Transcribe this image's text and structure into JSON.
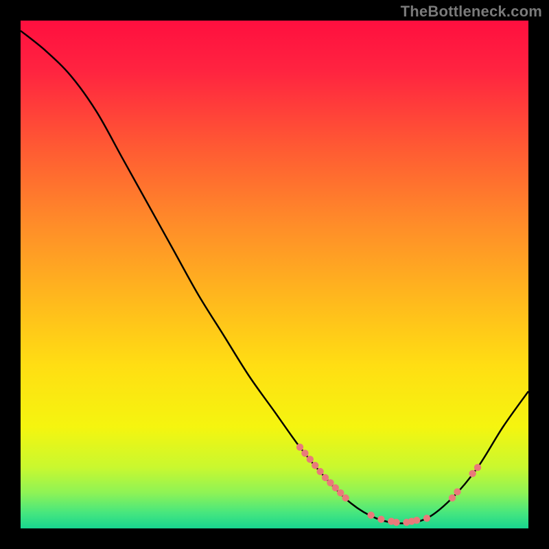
{
  "watermark": "TheBottleneck.com",
  "chart_data": {
    "type": "line",
    "title": "",
    "xlabel": "",
    "ylabel": "",
    "xlim": [
      0,
      100
    ],
    "ylim": [
      0,
      100
    ],
    "curve": [
      {
        "x": 0,
        "y": 98
      },
      {
        "x": 5,
        "y": 94
      },
      {
        "x": 10,
        "y": 89
      },
      {
        "x": 15,
        "y": 82
      },
      {
        "x": 20,
        "y": 73
      },
      {
        "x": 25,
        "y": 64
      },
      {
        "x": 30,
        "y": 55
      },
      {
        "x": 35,
        "y": 46
      },
      {
        "x": 40,
        "y": 38
      },
      {
        "x": 45,
        "y": 30
      },
      {
        "x": 50,
        "y": 23
      },
      {
        "x": 55,
        "y": 16
      },
      {
        "x": 60,
        "y": 10
      },
      {
        "x": 65,
        "y": 5
      },
      {
        "x": 70,
        "y": 2
      },
      {
        "x": 75,
        "y": 1
      },
      {
        "x": 80,
        "y": 2
      },
      {
        "x": 85,
        "y": 6
      },
      {
        "x": 90,
        "y": 12
      },
      {
        "x": 95,
        "y": 20
      },
      {
        "x": 100,
        "y": 27
      }
    ],
    "points_on_curve_x": [
      55,
      56,
      57,
      58,
      59,
      60,
      61,
      62,
      63,
      64,
      69,
      71,
      73,
      74,
      76,
      77,
      78,
      80,
      85,
      86,
      89,
      90
    ],
    "gradient_stops": [
      {
        "offset": 0.0,
        "color": "#ff0f3f"
      },
      {
        "offset": 0.1,
        "color": "#ff2440"
      },
      {
        "offset": 0.25,
        "color": "#ff5a33"
      },
      {
        "offset": 0.4,
        "color": "#ff8c29"
      },
      {
        "offset": 0.55,
        "color": "#ffb91d"
      },
      {
        "offset": 0.68,
        "color": "#ffde13"
      },
      {
        "offset": 0.8,
        "color": "#f5f50f"
      },
      {
        "offset": 0.88,
        "color": "#c9f82f"
      },
      {
        "offset": 0.93,
        "color": "#8ef356"
      },
      {
        "offset": 0.97,
        "color": "#45e67f"
      },
      {
        "offset": 1.0,
        "color": "#18d58f"
      }
    ],
    "point_color": "#e97a7a",
    "curve_color": "#000000",
    "plot_background_top": "#ff0f3f",
    "plot_background_bottom": "#18d58f"
  }
}
